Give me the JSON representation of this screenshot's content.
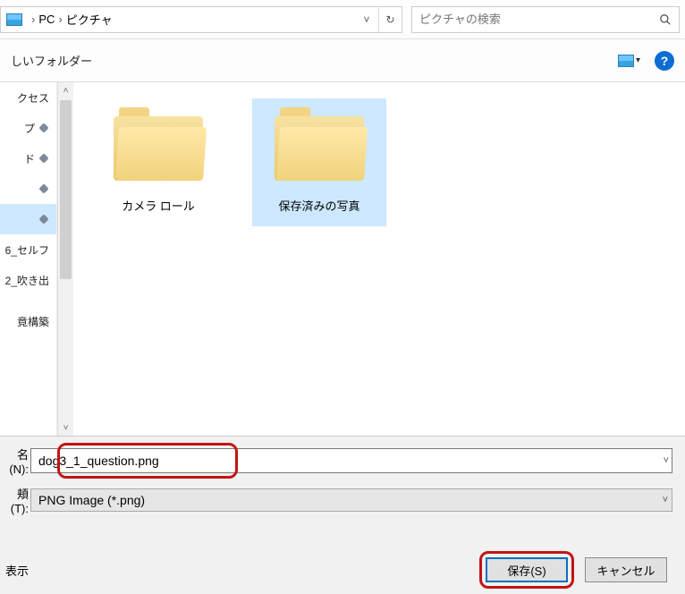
{
  "breadcrumb": {
    "root": "PC",
    "folder": "ピクチャ"
  },
  "search": {
    "placeholder": "ピクチャの検索"
  },
  "toolbar": {
    "new_folder": "しいフォルダー",
    "help": "?"
  },
  "sidebar": {
    "items": [
      {
        "label": "クセス"
      },
      {
        "label": "プ"
      },
      {
        "label": "ド"
      },
      {
        "label": ""
      },
      {
        "label": ""
      },
      {
        "label": "6_セルフ"
      },
      {
        "label": "2_吹き出"
      },
      {
        "label": "竟構築"
      }
    ]
  },
  "folders": [
    {
      "name": "カメラ ロール"
    },
    {
      "name": "保存済みの写真"
    }
  ],
  "filename": {
    "label": "名(N):",
    "value": "dog3_1_question.png"
  },
  "filetype": {
    "label": "頬(T):",
    "value": "PNG Image (*.png)"
  },
  "footer": {
    "hide": "表示",
    "save": "保存(S)",
    "cancel": "キャンセル"
  }
}
